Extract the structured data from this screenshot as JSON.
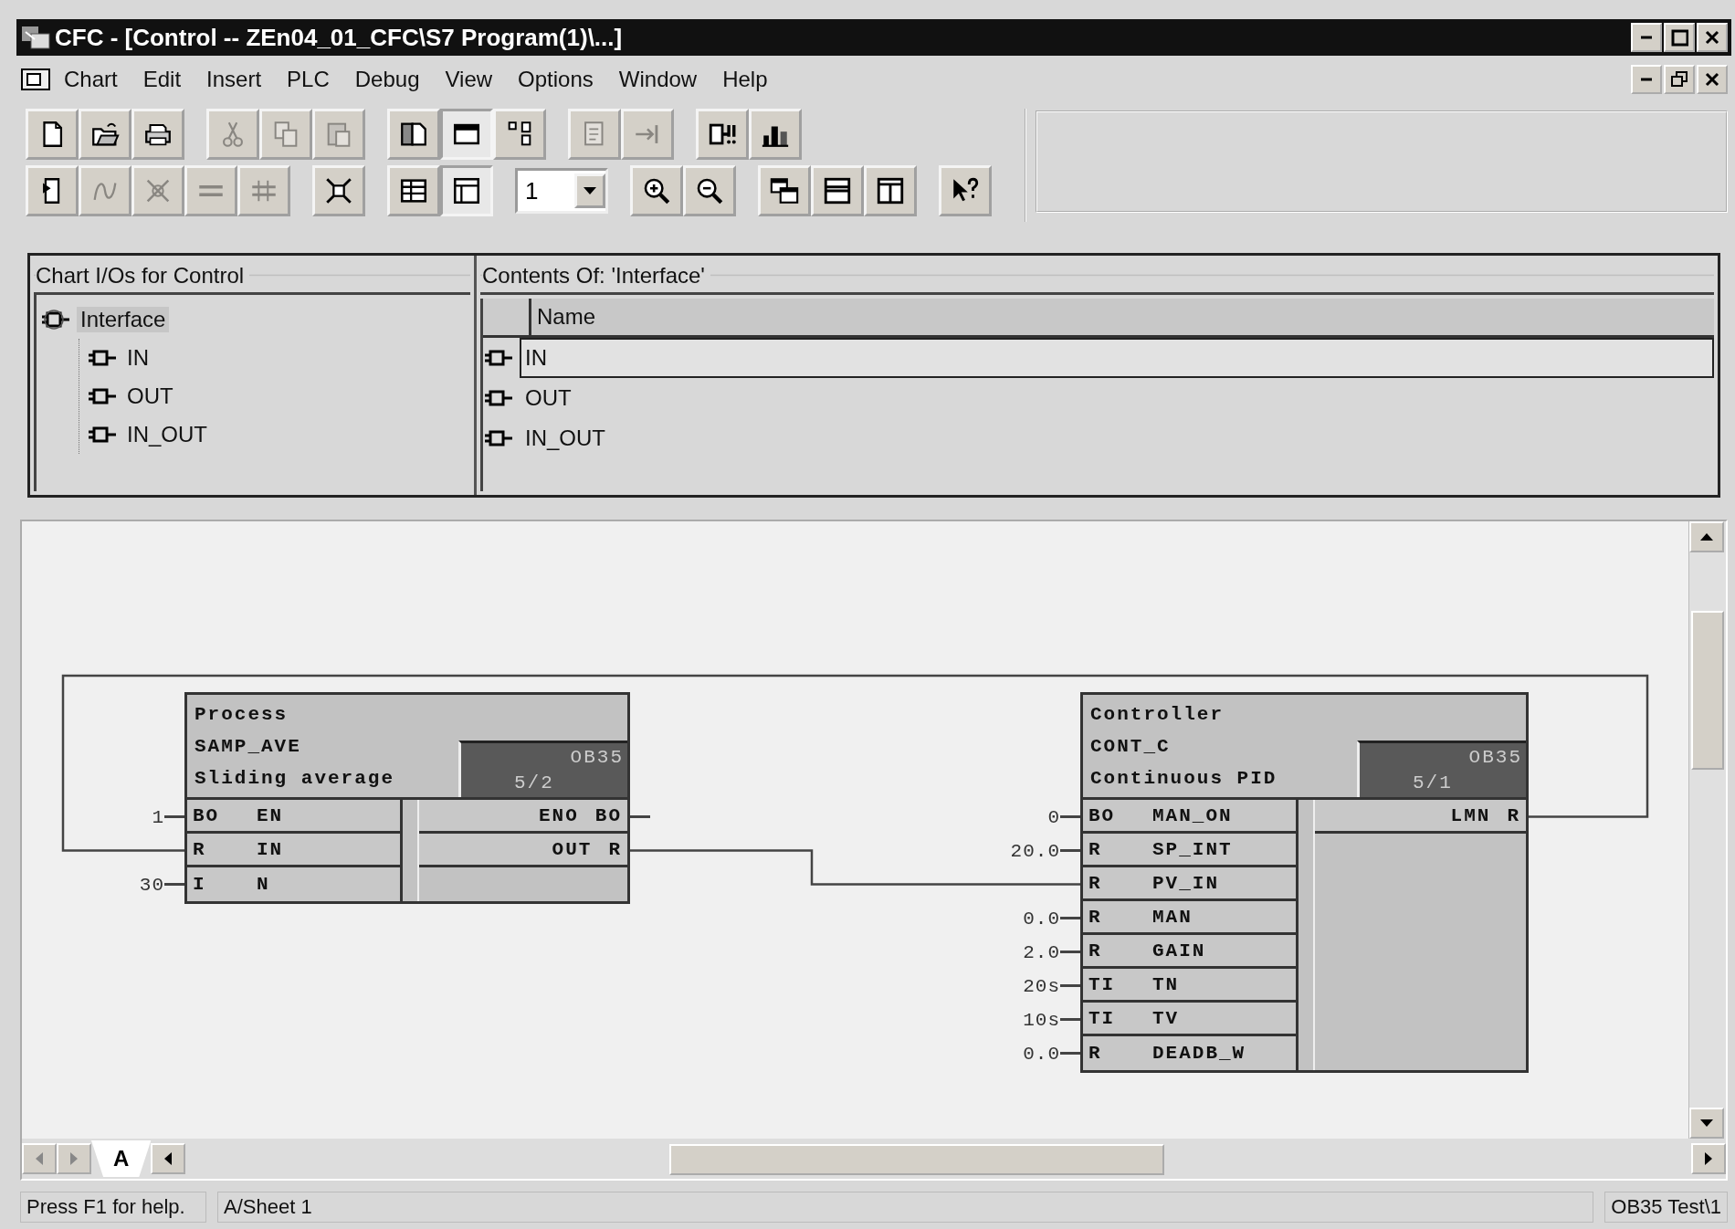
{
  "window": {
    "title": "CFC - [Control -- ZEn04_01_CFC\\S7 Program(1)\\...]"
  },
  "menu": [
    "Chart",
    "Edit",
    "Insert",
    "PLC",
    "Debug",
    "View",
    "Options",
    "Window",
    "Help"
  ],
  "toolbar": {
    "rows": [
      [
        [
          {
            "kind": "new",
            "disabled": false,
            "pressed": false
          },
          {
            "kind": "open",
            "disabled": false,
            "pressed": false
          },
          {
            "kind": "print",
            "disabled": false,
            "pressed": false
          }
        ],
        [
          {
            "kind": "cut",
            "disabled": true,
            "pressed": false
          },
          {
            "kind": "copy",
            "disabled": true,
            "pressed": false
          },
          {
            "kind": "paste",
            "disabled": true,
            "pressed": false
          }
        ],
        [
          {
            "kind": "book",
            "disabled": false,
            "pressed": false
          },
          {
            "kind": "window",
            "disabled": false,
            "pressed": true
          },
          {
            "kind": "blocks",
            "disabled": false,
            "pressed": false
          }
        ],
        [
          {
            "kind": "document",
            "disabled": true,
            "pressed": false
          },
          {
            "kind": "jump",
            "disabled": true,
            "pressed": false
          }
        ],
        [
          {
            "kind": "connector",
            "disabled": false,
            "pressed": false
          },
          {
            "kind": "chart",
            "disabled": false,
            "pressed": false
          }
        ]
      ],
      [
        [
          {
            "kind": "page-arrow",
            "disabled": false,
            "pressed": false
          },
          {
            "kind": "curve",
            "disabled": true,
            "pressed": false
          },
          {
            "kind": "cross",
            "disabled": true,
            "pressed": false
          },
          {
            "kind": "lines",
            "disabled": true,
            "pressed": false
          },
          {
            "kind": "crossed-lines",
            "disabled": true,
            "pressed": false
          }
        ],
        [
          {
            "kind": "expand",
            "disabled": false,
            "pressed": false
          }
        ],
        [
          {
            "kind": "grid",
            "disabled": false,
            "pressed": false
          },
          {
            "kind": "panel",
            "disabled": false,
            "pressed": true
          }
        ],
        [
          {
            "kind": "dropdown",
            "value": "1"
          }
        ],
        [
          {
            "kind": "zoom-in",
            "disabled": false,
            "pressed": false
          },
          {
            "kind": "zoom-out",
            "disabled": false,
            "pressed": false
          }
        ],
        [
          {
            "kind": "cascade",
            "disabled": false,
            "pressed": false
          },
          {
            "kind": "split-horizontal",
            "disabled": false,
            "pressed": false
          },
          {
            "kind": "split-vertical",
            "disabled": false,
            "pressed": false
          }
        ],
        [
          {
            "kind": "help",
            "disabled": false,
            "pressed": false
          }
        ]
      ]
    ]
  },
  "io_panel": {
    "tree_title": "Chart I/Os for Control",
    "tree": [
      {
        "label": "Interface",
        "selected": true,
        "expanded": true,
        "children": [
          {
            "label": "IN",
            "selected": false
          },
          {
            "label": "OUT",
            "selected": false
          },
          {
            "label": "IN_OUT",
            "selected": false
          }
        ]
      }
    ],
    "contents_title": "Contents Of: 'Interface'",
    "table": {
      "columns": [
        "Name"
      ],
      "rows": [
        {
          "name": "IN",
          "selected": true
        },
        {
          "name": "OUT",
          "selected": false
        },
        {
          "name": "IN_OUT",
          "selected": false
        }
      ]
    }
  },
  "chart": {
    "blocks": [
      {
        "name": "Process",
        "type": "SAMP_AVE",
        "comment": "Sliding average",
        "task": "OB35",
        "sequence": "5/2",
        "inputs": [
          {
            "type": "BO",
            "name": "EN",
            "value": "1",
            "connected": false
          },
          {
            "type": "R",
            "name": "IN",
            "connected": true
          },
          {
            "type": "I",
            "name": "N",
            "value": "30",
            "connected": false
          }
        ],
        "outputs": [
          {
            "name": "ENO",
            "type": "BO",
            "connected": false
          },
          {
            "name": "OUT",
            "type": "R",
            "connected": true
          }
        ]
      },
      {
        "name": "Controller",
        "type": "CONT_C",
        "comment": "Continuous PID",
        "task": "OB35",
        "sequence": "5/1",
        "inputs": [
          {
            "type": "BO",
            "name": "MAN_ON",
            "value": "0",
            "connected": false
          },
          {
            "type": "R",
            "name": "SP_INT",
            "value": "20.0",
            "connected": false
          },
          {
            "type": "R",
            "name": "PV_IN",
            "connected": true
          },
          {
            "type": "R",
            "name": "MAN",
            "value": "0.0",
            "connected": false
          },
          {
            "type": "R",
            "name": "GAIN",
            "value": "2.0",
            "connected": false
          },
          {
            "type": "TI",
            "name": "TN",
            "value": "20s",
            "connected": false
          },
          {
            "type": "TI",
            "name": "TV",
            "value": "10s",
            "connected": false
          },
          {
            "type": "R",
            "name": "DEADB_W",
            "value": "0.0",
            "connected": false
          }
        ],
        "outputs": [
          {
            "name": "LMN",
            "type": "R",
            "connected": true
          }
        ]
      }
    ],
    "sheet_tabs": [
      {
        "label": "A",
        "selected": true
      }
    ]
  },
  "status_bar": [
    "Press F1 for help.",
    "A/Sheet 1",
    "OB35  Test\\1"
  ]
}
